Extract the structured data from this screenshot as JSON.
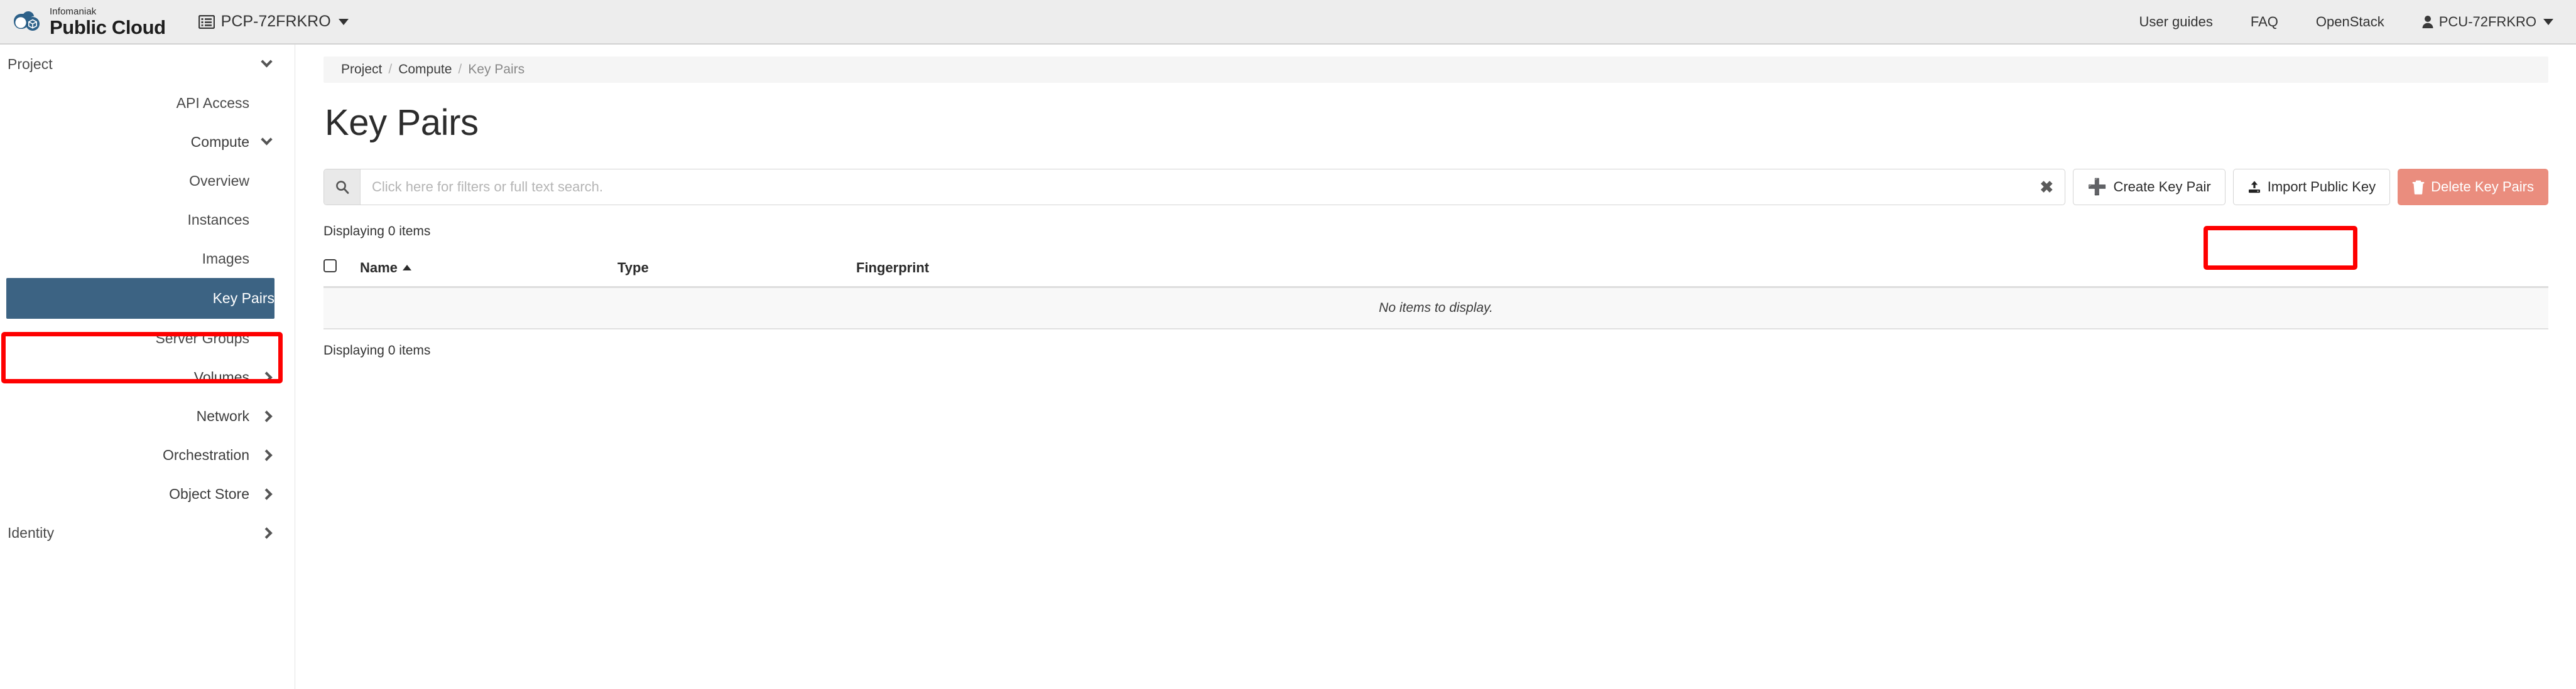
{
  "header": {
    "brand_sup": "Infomaniak",
    "brand_main": "Public Cloud",
    "project_selector": "PCP-72FRKRO",
    "nav": [
      {
        "label": "User guides"
      },
      {
        "label": "FAQ"
      },
      {
        "label": "OpenStack"
      }
    ],
    "user": "PCU-72FRKRO"
  },
  "sidebar": {
    "items": [
      {
        "label": "Project",
        "type": "top",
        "chevron": "down",
        "active": false
      },
      {
        "label": "API Access",
        "type": "sub",
        "chevron": "none",
        "active": false
      },
      {
        "label": "Compute",
        "type": "group",
        "chevron": "down",
        "active": false
      },
      {
        "label": "Overview",
        "type": "sub",
        "chevron": "none",
        "active": false
      },
      {
        "label": "Instances",
        "type": "sub",
        "chevron": "none",
        "active": false
      },
      {
        "label": "Images",
        "type": "sub",
        "chevron": "none",
        "active": false
      },
      {
        "label": "Key Pairs",
        "type": "sub",
        "chevron": "none",
        "active": true
      },
      {
        "label": "Server Groups",
        "type": "sub",
        "chevron": "none",
        "active": false
      },
      {
        "label": "Volumes",
        "type": "group",
        "chevron": "right",
        "active": false
      },
      {
        "label": "Network",
        "type": "group",
        "chevron": "right",
        "active": false
      },
      {
        "label": "Orchestration",
        "type": "group",
        "chevron": "right",
        "active": false
      },
      {
        "label": "Object Store",
        "type": "group",
        "chevron": "right",
        "active": false
      },
      {
        "label": "Identity",
        "type": "top",
        "chevron": "right",
        "active": false
      }
    ]
  },
  "breadcrumb": {
    "items": [
      "Project",
      "Compute",
      "Key Pairs"
    ],
    "separator": "/"
  },
  "page": {
    "title": "Key Pairs"
  },
  "search": {
    "placeholder": "Click here for filters or full text search.",
    "value": "",
    "clear_label": "✖"
  },
  "toolbar": {
    "create_label": "Create Key Pair",
    "create_icon": "plus-icon",
    "import_label": "Import Public Key",
    "import_icon": "upload-icon",
    "delete_label": "Delete Key Pairs",
    "delete_icon": "trash-icon"
  },
  "table": {
    "count_top": "Displaying 0 items",
    "count_bottom": "Displaying 0 items",
    "columns": [
      "Name",
      "Type",
      "Fingerprint"
    ],
    "sort_column": "Name",
    "sort_direction": "asc",
    "rows": [],
    "empty_message": "No items to display."
  },
  "colors": {
    "header_bg": "#ededed",
    "sidebar_active": "#3c6383",
    "annotation": "#fe0000",
    "danger_disabled": "#ea8d7e",
    "brand_blue": "#2d6189"
  }
}
